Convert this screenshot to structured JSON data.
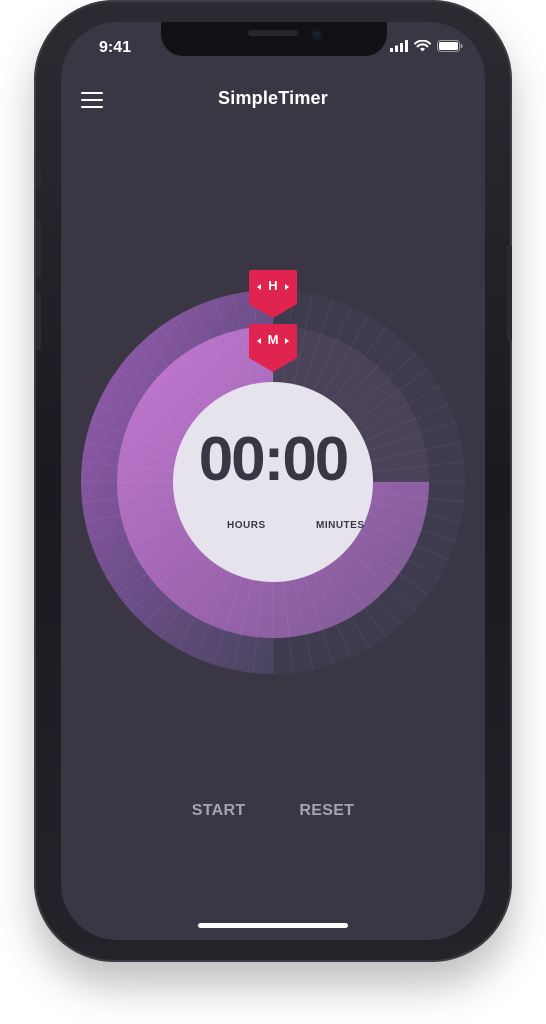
{
  "status_bar": {
    "time": "9:41",
    "icons": [
      "signal-icon",
      "wifi-icon",
      "battery-icon"
    ]
  },
  "header": {
    "title": "SimpleTimer",
    "menu_icon": "hamburger-menu-icon"
  },
  "timer": {
    "readout": "00:00",
    "hours_label": "HOURS",
    "minutes_label": "MINUTES",
    "hour_marker": "H",
    "minute_marker": "M",
    "hour_marker_icon": "hour-handle-icon",
    "minute_marker_icon": "minute-handle-icon"
  },
  "controls": {
    "start_label": "START",
    "reset_label": "RESET"
  },
  "colors": {
    "background": "#3a3644",
    "accent": "#e0234f",
    "ring_outer": "#8b5aa3",
    "ring_inner": "#b06ec3",
    "face": "#e6e3ec",
    "muted_text": "#a6a2b2"
  }
}
